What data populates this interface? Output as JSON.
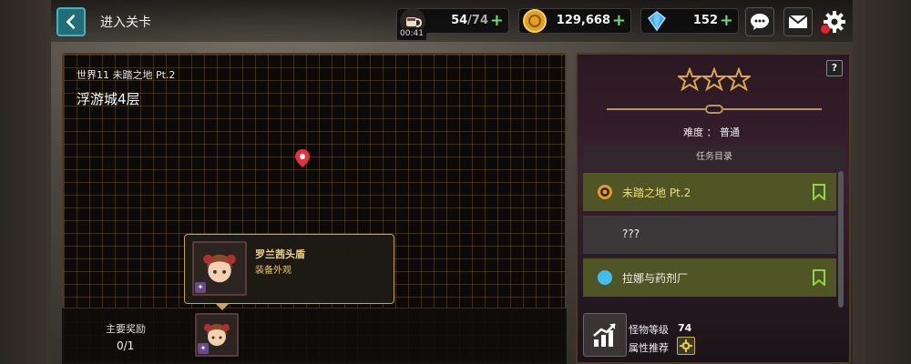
{
  "header": {
    "title": "进入关卡",
    "stamina": {
      "value": "54",
      "max": "74",
      "timer": "00:41",
      "icon": "coffee-cup-icon"
    },
    "gold": {
      "value": "129,668",
      "icon": "gold-coin-icon"
    },
    "gems": {
      "value": "152",
      "icon": "blue-gem-icon"
    },
    "plus": "+",
    "buttons": [
      "chat-icon",
      "mail-icon",
      "settings-gear-icon"
    ]
  },
  "map": {
    "subtitle": "世界11  未踏之地  Pt.2",
    "title": "浮游城4层"
  },
  "rewards": {
    "label": "主要奖励",
    "count": "0/1"
  },
  "tooltip": {
    "name": "罗兰茜头盾",
    "type": "装备外观"
  },
  "stage": {
    "stars_filled": 0,
    "stars_total": 3,
    "difficulty": "难度  ：  普通",
    "help": "?"
  },
  "quests": {
    "header": "任务目录",
    "items": [
      {
        "label": "未踏之地  Pt.2",
        "state": "active"
      },
      {
        "label": "???",
        "state": "locked"
      },
      {
        "label": "拉娜与药剂厂",
        "state": "active"
      }
    ]
  },
  "monster": {
    "level_label": "怪物等级",
    "level_value": "74",
    "attr_label": "属性推荐"
  },
  "colors": {
    "accent_teal": "#1f6e7a",
    "plus_green": "#6fd67a",
    "quest_active": "#4f5524",
    "quest_locked": "#3a3838",
    "gold_text": "#f0d080"
  }
}
